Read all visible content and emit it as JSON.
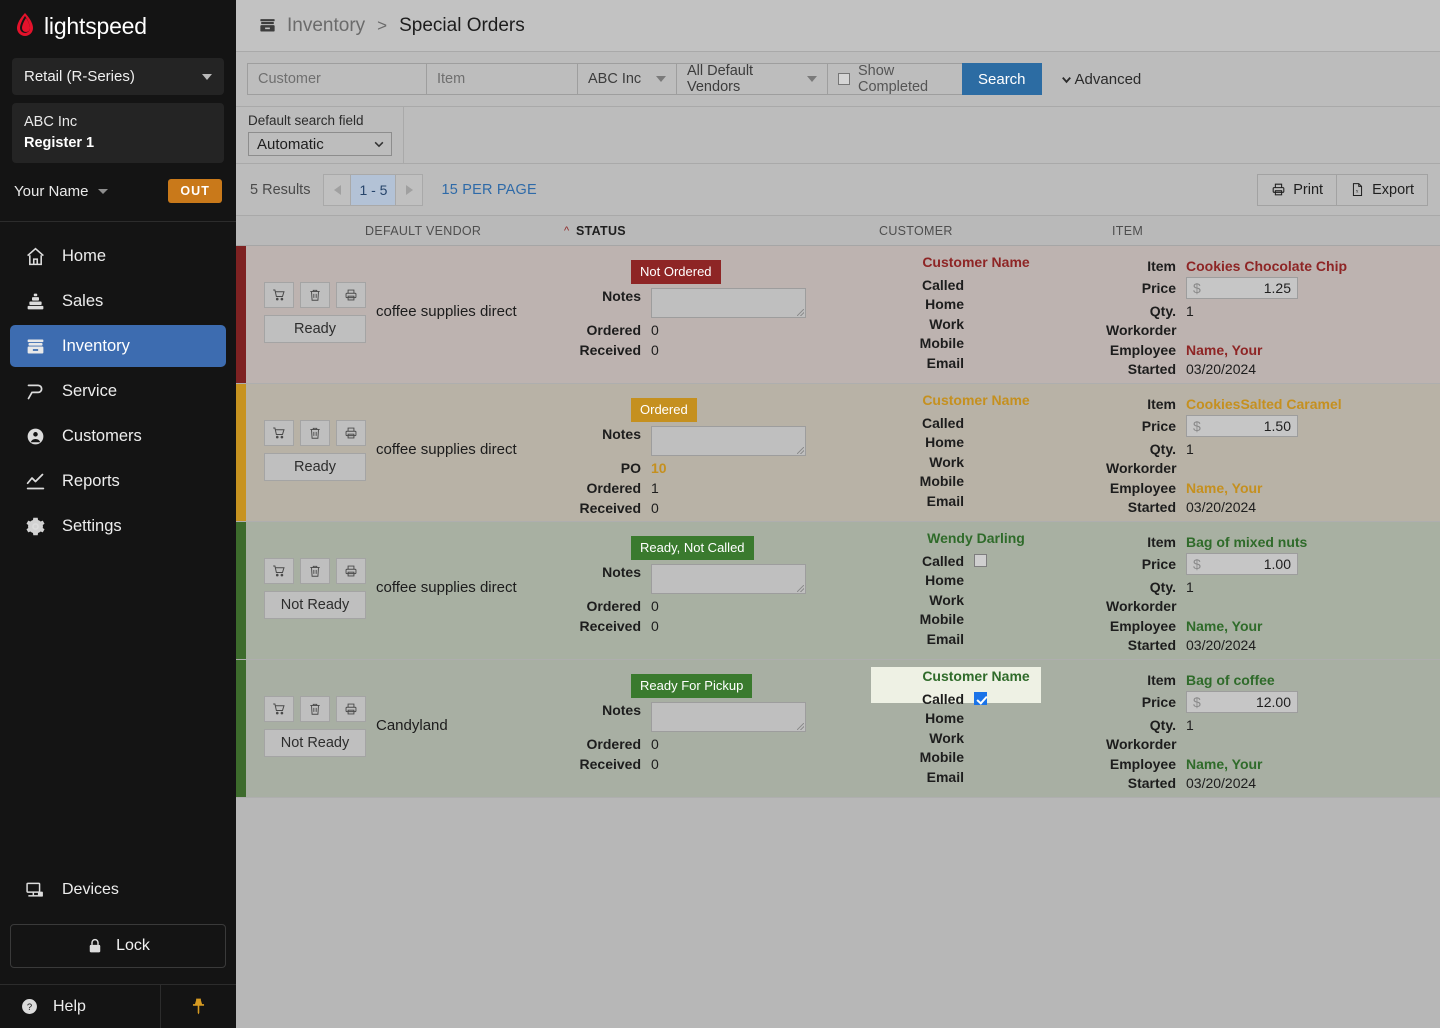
{
  "sidebar": {
    "brand": "lightspeed",
    "product_select": "Retail (R-Series)",
    "store_name": "ABC Inc",
    "register": "Register 1",
    "user_name": "Your Name",
    "out_button": "OUT",
    "items": [
      {
        "label": "Home",
        "icon": "home-icon"
      },
      {
        "label": "Sales",
        "icon": "sales-icon"
      },
      {
        "label": "Inventory",
        "icon": "inventory-icon"
      },
      {
        "label": "Service",
        "icon": "service-icon"
      },
      {
        "label": "Customers",
        "icon": "customers-icon"
      },
      {
        "label": "Reports",
        "icon": "reports-icon"
      },
      {
        "label": "Settings",
        "icon": "settings-icon"
      }
    ],
    "devices": "Devices",
    "lock": "Lock",
    "help": "Help",
    "accent_active": "#3d6cb0",
    "accent_out": "#c9791a"
  },
  "breadcrumb": {
    "section": "Inventory",
    "separator": ">",
    "page": "Special Orders"
  },
  "search": {
    "customer_placeholder": "Customer",
    "item_placeholder": "Item",
    "store_select": "ABC Inc",
    "vendor_select": "All Default Vendors",
    "show_completed_label": "Show Completed",
    "show_completed_checked": false,
    "search_button": "Search",
    "advanced_label": "Advanced"
  },
  "filters": {
    "default_search_field_label": "Default search field",
    "default_search_field_value": "Automatic"
  },
  "results": {
    "count_label": "5 Results",
    "prev": "prev",
    "page_range": "1 - 5",
    "next": "next",
    "per_page": "15 PER PAGE",
    "print": "Print",
    "export": "Export"
  },
  "columns": {
    "vendor": "DEFAULT VENDOR",
    "status": "STATUS",
    "status_sort": "^",
    "customer": "CUSTOMER",
    "item": "ITEM"
  },
  "labels": {
    "notes": "Notes",
    "po": "PO",
    "ordered": "Ordered",
    "received": "Received",
    "called": "Called",
    "home": "Home",
    "work": "Work",
    "mobile": "Mobile",
    "email": "Email",
    "item": "Item",
    "price": "Price",
    "qty": "Qty.",
    "workorder": "Workorder",
    "employee": "Employee",
    "started": "Started",
    "currency": "$",
    "ready": "Ready",
    "not_ready": "Not Ready"
  },
  "rows": [
    {
      "stripe_color": "#7e2222",
      "bg_color": "#bdb3b0",
      "accent_color": "#8e2525",
      "badge_color": "#8e2525",
      "status": "Not Ordered",
      "vendor": "coffee supplies direct",
      "ready_button": "Ready",
      "notes": "",
      "po": null,
      "ordered": "0",
      "received": "0",
      "customer_name": "Customer Name",
      "called_checkbox": null,
      "home": "",
      "work": "",
      "mobile": "",
      "email": "",
      "item": "Cookies Chocolate Chip",
      "price": "1.25",
      "qty": "1",
      "workorder": "",
      "employee": "Name, Your",
      "started": "03/20/2024",
      "highlighted": false
    },
    {
      "stripe_color": "#c79320",
      "bg_color": "#b8b2a6",
      "accent_color": "#c5901f",
      "badge_color": "#c5901f",
      "status": "Ordered",
      "vendor": "coffee supplies direct",
      "ready_button": "Ready",
      "notes": "",
      "po": "10",
      "ordered": "1",
      "received": "0",
      "customer_name": "Customer Name",
      "called_checkbox": null,
      "home": "",
      "work": "",
      "mobile": "",
      "email": "",
      "item": "CookiesSalted Caramel",
      "price": "1.50",
      "qty": "1",
      "workorder": "",
      "employee": "Name, Your",
      "started": "03/20/2024",
      "highlighted": false
    },
    {
      "stripe_color": "#3d6b2c",
      "bg_color": "#a8b0a2",
      "accent_color": "#2f6b2a",
      "badge_color": "#3a7a2e",
      "status": "Ready, Not Called",
      "vendor": "coffee supplies direct",
      "ready_button": "Not Ready",
      "notes": "",
      "po": null,
      "ordered": "0",
      "received": "0",
      "customer_name": "Wendy Darling",
      "called_checkbox": false,
      "home": "",
      "work": "",
      "mobile": "",
      "email": "",
      "item": "Bag of mixed nuts",
      "price": "1.00",
      "qty": "1",
      "workorder": "",
      "employee": "Name, Your",
      "started": "03/20/2024",
      "highlighted": false
    },
    {
      "stripe_color": "#3d6b2c",
      "bg_color": "#a8afa3",
      "accent_color": "#2f6b2a",
      "badge_color": "#3a7a2e",
      "status": "Ready For Pickup",
      "vendor": "Candyland",
      "ready_button": "Not Ready",
      "notes": "",
      "po": null,
      "ordered": "0",
      "received": "0",
      "customer_name": "Customer Name",
      "called_checkbox": true,
      "home": "",
      "work": "",
      "mobile": "",
      "email": "",
      "item": "Bag of coffee",
      "price": "12.00",
      "qty": "1",
      "workorder": "",
      "employee": "Name, Your",
      "started": "03/20/2024",
      "highlighted": true
    }
  ]
}
